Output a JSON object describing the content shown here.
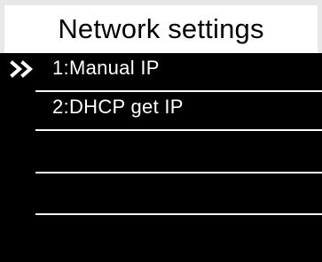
{
  "header": {
    "title": "Network settings"
  },
  "menu": {
    "items": [
      {
        "label": "1:Manual IP",
        "selected": true
      },
      {
        "label": "2:DHCP get IP",
        "selected": false
      },
      {
        "label": "",
        "selected": false
      },
      {
        "label": "",
        "selected": false
      },
      {
        "label": "",
        "selected": false
      }
    ],
    "selector_icon": "double-chevron-right-icon"
  },
  "colors": {
    "background": "#000000",
    "header_background": "#ffffff",
    "header_text": "#000000",
    "text": "#ffffff",
    "divider": "#ffffff"
  }
}
